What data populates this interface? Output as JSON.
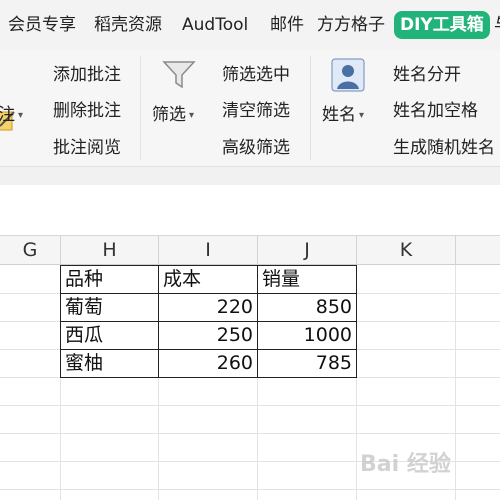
{
  "menu_tabs": [
    "会员专享",
    "稻壳资源",
    "AudTool",
    "邮件",
    "方方格子",
    "DIY工具箱",
    "与"
  ],
  "ribbon": {
    "comment_group": {
      "dropdown_label": "注",
      "items": [
        "添加批注",
        "删除批注",
        "批注阅览"
      ]
    },
    "filter_group": {
      "dropdown_label": "筛选",
      "items": [
        "筛选选中",
        "清空筛选",
        "高级筛选"
      ]
    },
    "name_group": {
      "dropdown_label": "姓名",
      "items": [
        "姓名分开",
        "姓名加空格",
        "生成随机姓名"
      ]
    }
  },
  "columns": [
    "G",
    "H",
    "I",
    "J",
    "K"
  ],
  "table": {
    "headers": [
      "品种",
      "成本",
      "销量"
    ],
    "rows": [
      [
        "葡萄",
        "220",
        "850"
      ],
      [
        "西瓜",
        "250",
        "1000"
      ],
      [
        "蜜柚",
        "260",
        "785"
      ]
    ]
  },
  "watermark": "Bai 经验"
}
